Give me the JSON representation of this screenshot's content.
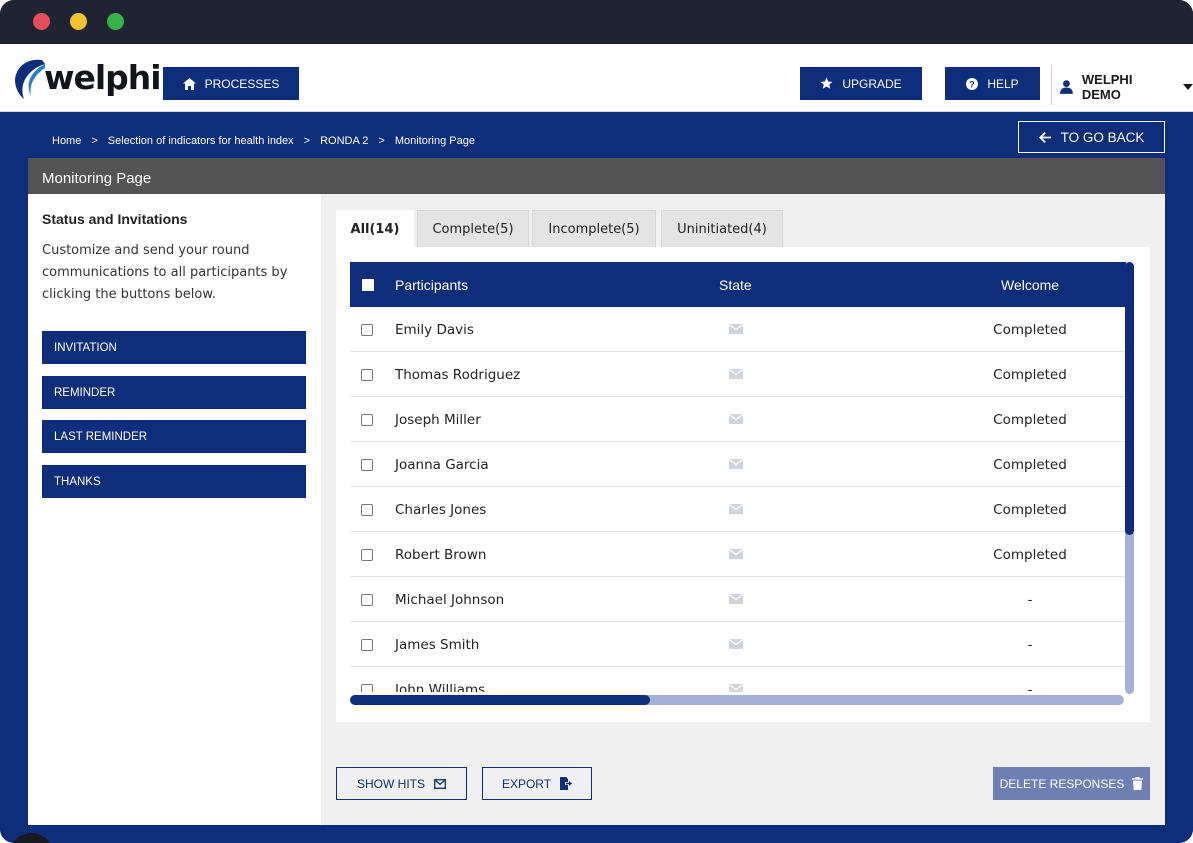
{
  "app": {
    "logo_text": "welphi"
  },
  "nav": {
    "processes_label": "PROCESSES",
    "upgrade_label": "UPGRADE",
    "help_label": "HELP",
    "user_label": "WELPHI DEMO"
  },
  "breadcrumb": {
    "items": [
      "Home",
      ">",
      "Selection of indicators for health index",
      ">",
      "RONDA 2",
      ">",
      "Monitoring Page"
    ]
  },
  "go_back_label": "TO GO BACK",
  "panel": {
    "title": "Monitoring Page"
  },
  "sidebar": {
    "title": "Status and Invitations",
    "description": "Customize and send your round communications to all participants by clicking the buttons below.",
    "buttons": [
      "INVITATION",
      "REMINDER",
      "LAST REMINDER",
      "THANKS"
    ]
  },
  "tabs": [
    {
      "label": "All(14)",
      "active": true
    },
    {
      "label": "Complete(5)",
      "active": false
    },
    {
      "label": "Incomplete(5)",
      "active": false
    },
    {
      "label": "Uninitiated(4)",
      "active": false
    }
  ],
  "table": {
    "columns": [
      "Participants",
      "State",
      "Welcome"
    ],
    "rows": [
      {
        "name": "Emily Davis",
        "state_icon": "envelope-icon",
        "welcome": "Completed"
      },
      {
        "name": "Thomas Rodriguez",
        "state_icon": "envelope-icon",
        "welcome": "Completed"
      },
      {
        "name": "Joseph Miller",
        "state_icon": "envelope-icon",
        "welcome": "Completed"
      },
      {
        "name": "Joanna Garcia",
        "state_icon": "envelope-icon",
        "welcome": "Completed"
      },
      {
        "name": "Charles Jones",
        "state_icon": "envelope-icon",
        "welcome": "Completed"
      },
      {
        "name": "Robert Brown",
        "state_icon": "envelope-icon",
        "welcome": "Completed"
      },
      {
        "name": "Michael Johnson",
        "state_icon": "envelope-icon",
        "welcome": "-"
      },
      {
        "name": "James Smith",
        "state_icon": "envelope-icon",
        "welcome": "-"
      },
      {
        "name": "John Williams",
        "state_icon": "envelope-icon",
        "welcome": "-"
      }
    ]
  },
  "actions": {
    "show_hits_label": "SHOW HITS",
    "export_label": "EXPORT",
    "delete_label": "DELETE RESPONSES"
  },
  "colors": {
    "brand_navy": "#0e2d7a",
    "panel_header": "#545454",
    "delete_button": "#6d7fb3"
  }
}
